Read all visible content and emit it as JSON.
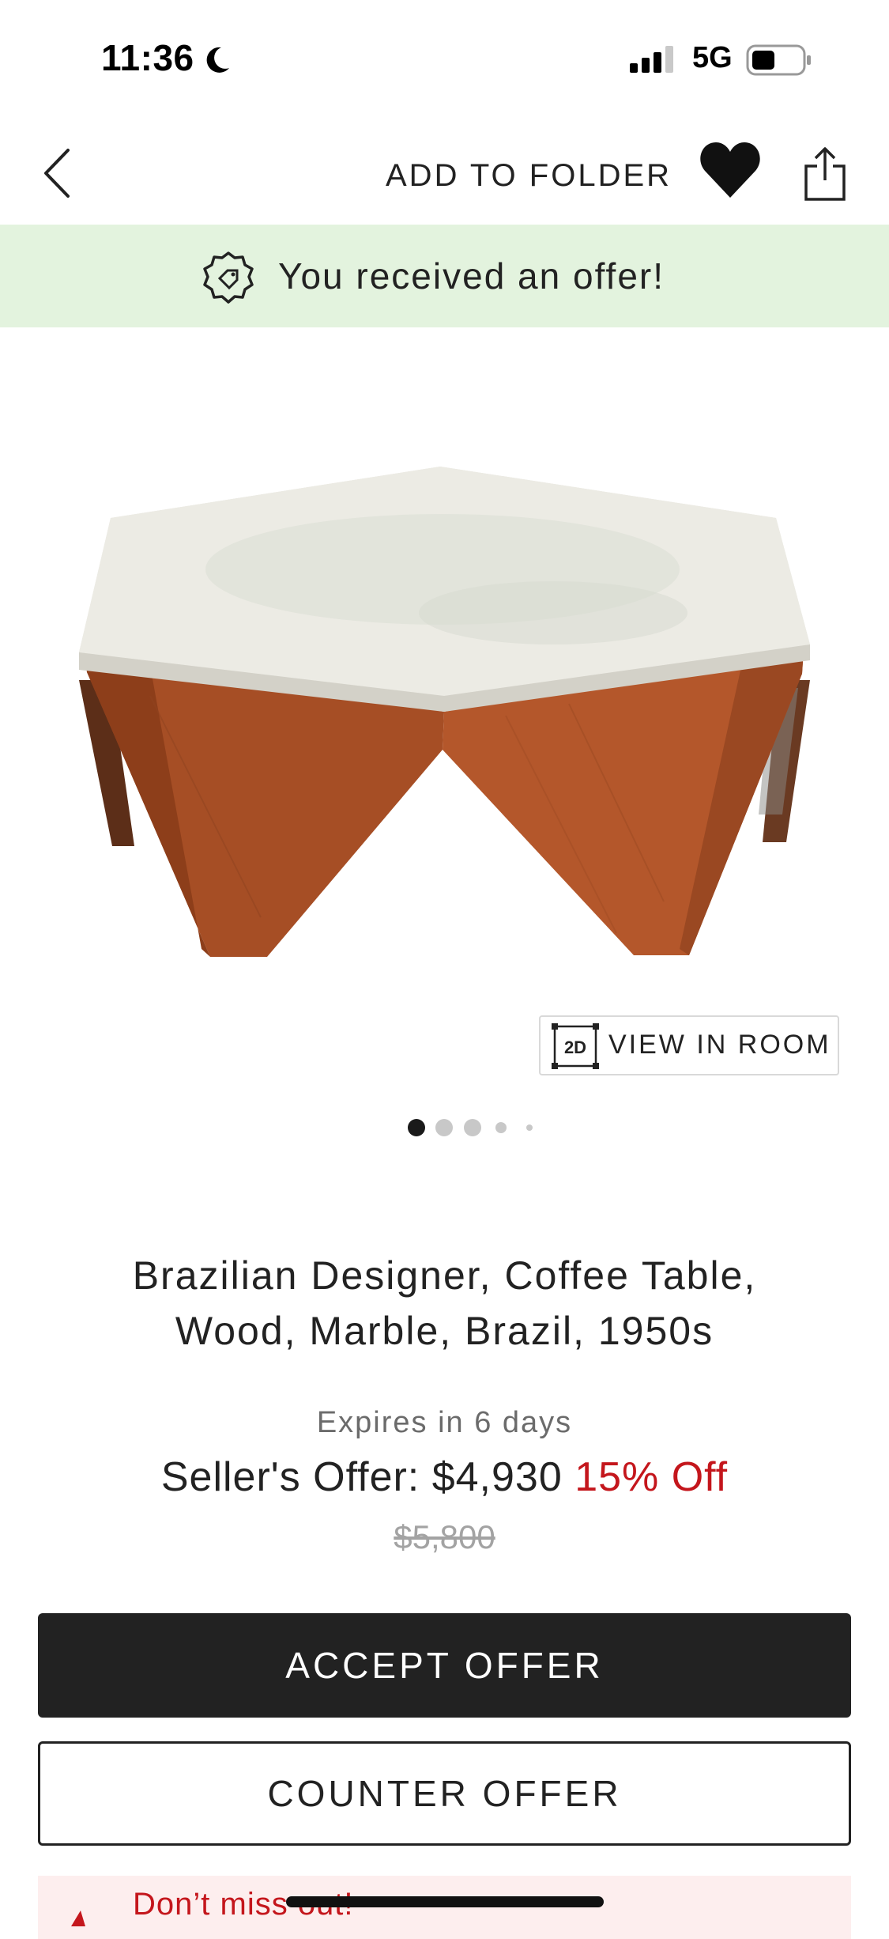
{
  "status_bar": {
    "time": "11:36",
    "network": "5G"
  },
  "nav": {
    "add_to_folder": "ADD TO FOLDER"
  },
  "banner": {
    "text": "You received an offer!",
    "color": "#e3f3de"
  },
  "gallery": {
    "view_in_room_badge": "2D",
    "view_in_room": "VIEW IN ROOM",
    "page_dots": 5,
    "active_dot": 1
  },
  "product": {
    "title_line1": "Brazilian Designer, Coffee Table,",
    "title_line2": "Wood, Marble, Brazil, 1950s"
  },
  "offer": {
    "expires": "Expires in 6 days",
    "label": "Seller's Offer: $4,930",
    "discount": "15% Off",
    "original_price": "$5,800",
    "accent_color": "#c4161c"
  },
  "actions": {
    "accept": "ACCEPT OFFER",
    "counter": "COUNTER OFFER"
  },
  "promo": {
    "text": "Don’t miss out!"
  }
}
